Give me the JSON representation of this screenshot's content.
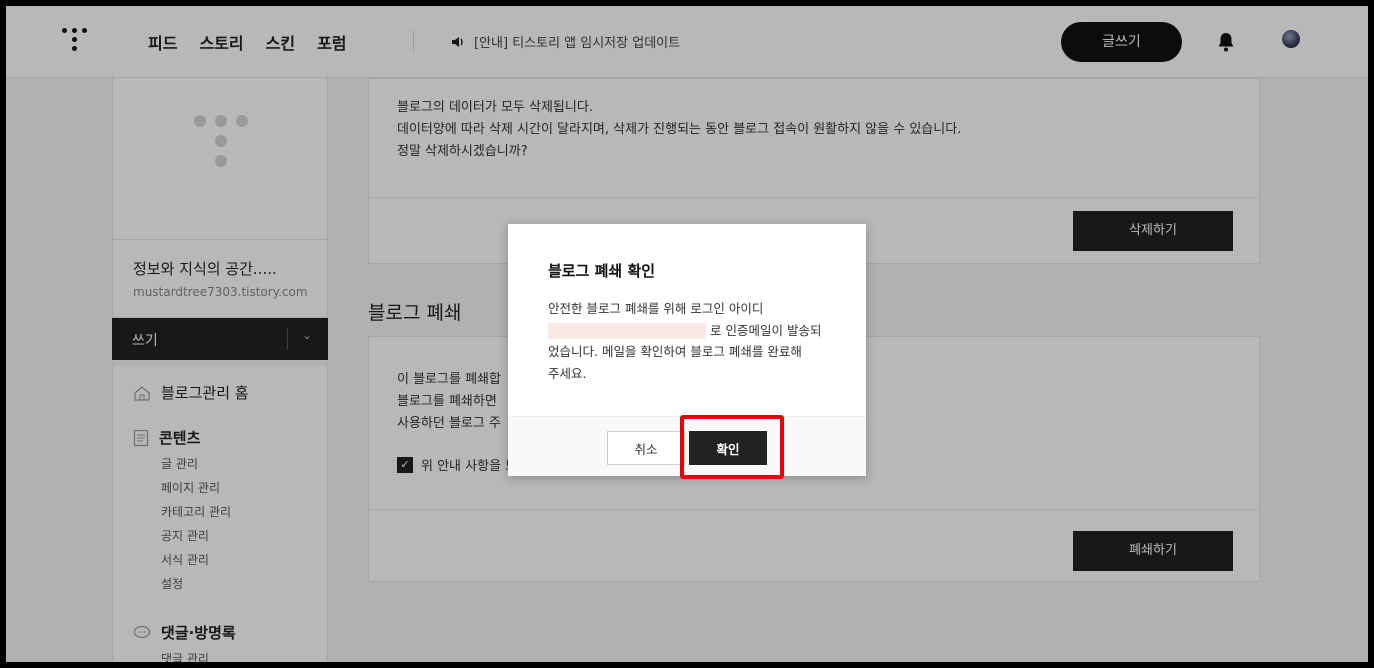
{
  "header": {
    "nav": [
      "피드",
      "스토리",
      "스킨",
      "포럼"
    ],
    "notice": "[안내] 티스토리 앱 임시저장 업데이트",
    "write_label": "글쓰기"
  },
  "sidebar": {
    "blog_title": "정보와 지식의 공간.....",
    "blog_url": "mustardtree7303.tistory.com",
    "write_label": "쓰기",
    "menu": {
      "home": "블로그관리 홈",
      "contents": "콘텐츠",
      "contents_items": [
        "글 관리",
        "페이지 관리",
        "카테고리 관리",
        "공지 관리",
        "서식 관리",
        "설정"
      ],
      "comments": "댓글·방명록",
      "comments_items": [
        "댓글 관리"
      ]
    }
  },
  "main": {
    "delete_card": {
      "lines": [
        "블로그의 데이터가 모두 삭제됩니다.",
        "데이터양에 따라 삭제 시간이 달라지며, 삭제가 진행되는 동안 블로그 접속이 원활하지 않을 수 있습니다.",
        "정말 삭제하시겠습니까?"
      ],
      "button": "삭제하기"
    },
    "close_section_title": "블로그 폐쇄",
    "close_card": {
      "lines": [
        "이 블로그를 폐쇄합",
        "블로그를 폐쇄하면",
        "사용하던 블로그 주"
      ],
      "checkbox_label": "위 안내 사항을 모",
      "button": "폐쇄하기"
    }
  },
  "modal": {
    "title": "블로그 폐쇄 확인",
    "body_line1": "안전한 블로그 폐쇄를 위해 로그인 아이디",
    "body_line2_suffix": "로 인증메일이 발송되",
    "body_line3": "었습니다. 메일을 확인하여 블로그 폐쇄를 완료해",
    "body_line4": "주세요.",
    "cancel": "취소",
    "confirm": "확인"
  },
  "colors": {
    "accent": "#222222",
    "highlight": "#e8000b"
  }
}
